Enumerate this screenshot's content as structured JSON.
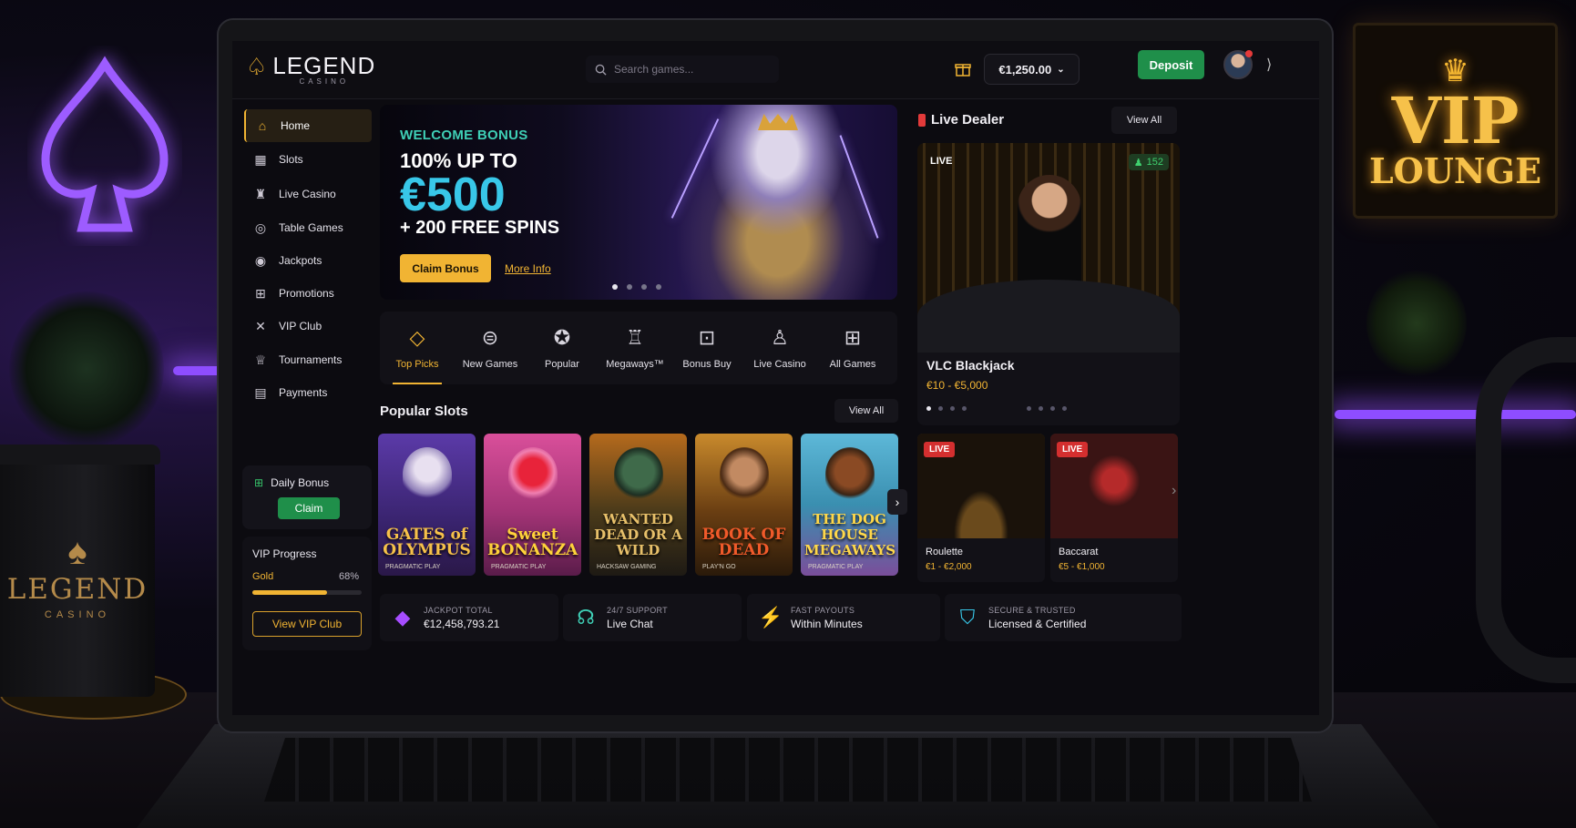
{
  "colors": {
    "gold": "#f1b433",
    "green": "#1f8f4a",
    "teal": "#3fcfb6",
    "cyan": "#38c7e8",
    "live_red": "#d42f2f",
    "bg": "#0c0b10"
  },
  "scene": {
    "cup": {
      "brand": "LEGEND",
      "sub": "CASINO"
    },
    "sign": {
      "line1": "VIP",
      "line2": "LOUNGE"
    }
  },
  "header": {
    "logo_name": "LEGEND",
    "logo_sub": "CASINO",
    "search_placeholder": "Search games...",
    "balance": "€1,250.00",
    "deposit_label": "Deposit"
  },
  "sidebar": {
    "items": [
      {
        "label": "Home",
        "icon": "home-icon",
        "active": true
      },
      {
        "label": "Slots",
        "icon": "slot-machine-icon"
      },
      {
        "label": "Live Casino",
        "icon": "live-casino-icon"
      },
      {
        "label": "Table Games",
        "icon": "chip-icon"
      },
      {
        "label": "Jackpots",
        "icon": "jackpot-icon"
      },
      {
        "label": "Promotions",
        "icon": "gift-icon"
      },
      {
        "label": "VIP Club",
        "icon": "vip-icon"
      },
      {
        "label": "Tournaments",
        "icon": "trophy-icon"
      },
      {
        "label": "Payments",
        "icon": "wallet-icon"
      }
    ],
    "daily_bonus": {
      "title": "Daily Bonus",
      "button": "Claim"
    },
    "vip_progress": {
      "title": "VIP Progress",
      "tier": "Gold",
      "percent_label": "68%",
      "progress": 0.68,
      "button": "View VIP Club"
    }
  },
  "hero": {
    "eyebrow": "WELCOME BONUS",
    "line1": "100% UP TO",
    "amount": "€500",
    "line2": "+ 200 FREE SPINS",
    "claim_label": "Claim Bonus",
    "more_label": "More Info",
    "slides": 4,
    "active_slide": 0
  },
  "categories": [
    {
      "label": "Top Picks",
      "icon": "diamond-icon",
      "active": true
    },
    {
      "label": "New Games",
      "icon": "new-badge-icon"
    },
    {
      "label": "Popular",
      "icon": "star-icon"
    },
    {
      "label": "Megaways™",
      "icon": "megaways-icon"
    },
    {
      "label": "Bonus Buy",
      "icon": "bonus-buy-icon"
    },
    {
      "label": "Live Casino",
      "icon": "dealer-icon"
    },
    {
      "label": "All Games",
      "icon": "grid-icon"
    }
  ],
  "popular": {
    "title": "Popular Slots",
    "view_all": "View All",
    "games": [
      {
        "name": "GATES of OLYMPUS",
        "provider": "PRAGMATIC PLAY"
      },
      {
        "name": "Sweet BONANZA",
        "provider": "PRAGMATIC PLAY"
      },
      {
        "name": "WANTED DEAD OR A WILD",
        "provider": "HACKSAW GAMING"
      },
      {
        "name": "BOOK OF DEAD",
        "provider": "PLAY'N GO"
      },
      {
        "name": "THE DOG HOUSE MEGAWAYS",
        "provider": "PRAGMATIC PLAY"
      }
    ]
  },
  "live": {
    "title": "Live Dealer",
    "view_all": "View All",
    "featured": {
      "badge": "LIVE",
      "viewers": "152",
      "name": "VLC Blackjack",
      "limits": "€10 - €5,000"
    },
    "tables": [
      {
        "badge": "LIVE",
        "name": "Roulette",
        "limits": "€1 - €2,000"
      },
      {
        "badge": "LIVE",
        "name": "Baccarat",
        "limits": "€5 - €1,000"
      }
    ]
  },
  "stats": [
    {
      "label": "JACKPOT TOTAL",
      "value": "€12,458,793.21",
      "icon": "gem-icon"
    },
    {
      "label": "24/7 SUPPORT",
      "value": "Live Chat",
      "icon": "headset-icon"
    },
    {
      "label": "FAST PAYOUTS",
      "value": "Within Minutes",
      "icon": "lightning-icon"
    },
    {
      "label": "SECURE & TRUSTED",
      "value": "Licensed & Certified",
      "icon": "shield-icon"
    }
  ]
}
